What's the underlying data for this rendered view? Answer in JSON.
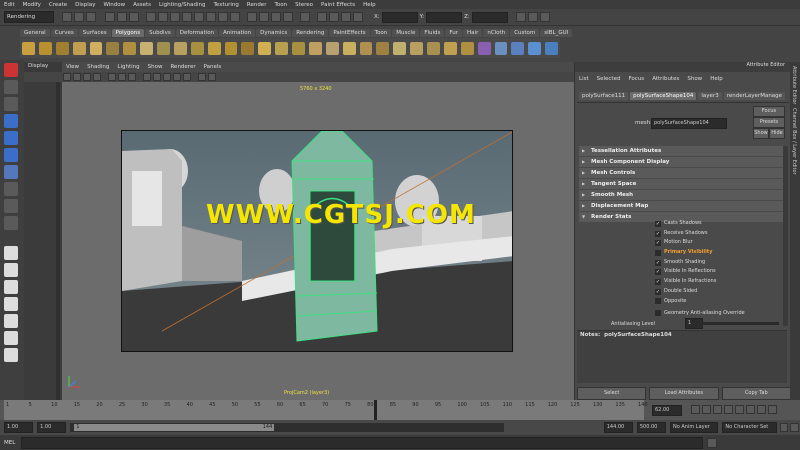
{
  "menubar": {
    "items": [
      "Edit",
      "Modify",
      "Create",
      "Display",
      "Window",
      "Assets",
      "Lighting/Shading",
      "Texturing",
      "Render",
      "Toon",
      "Stereo",
      "Paint Effects",
      "Help"
    ]
  },
  "statusline": {
    "mode": "Rendering",
    "x_label": "X:",
    "y_label": "Y:",
    "z_label": "Z:"
  },
  "shelf_tabs": {
    "items": [
      "General",
      "Curves",
      "Surfaces",
      "Polygons",
      "Subdivs",
      "Deformation",
      "Animation",
      "Dynamics",
      "Rendering",
      "PaintEffects",
      "Toon",
      "Muscle",
      "Fluids",
      "Fur",
      "Hair",
      "nCloth",
      "Custom",
      "sIBL_GUI"
    ],
    "active": "Polygons"
  },
  "viewport": {
    "layer_header": "Display",
    "menu": [
      "View",
      "Shading",
      "Lighting",
      "Show",
      "Renderer",
      "Panels"
    ],
    "resolution": "5760 x 3240",
    "camera_label": "ProjCam2 (layer3)"
  },
  "watermark": "WWW.CGTSJ.COM",
  "attribute_editor": {
    "title": "Attribute Editor",
    "menu": [
      "List",
      "Selected",
      "Focus",
      "Attributes",
      "Show",
      "Help"
    ],
    "tabs": [
      "polySurface111",
      "polySurfaceShape104",
      "layer3",
      "renderLayerManage"
    ],
    "active_tab": "polySurfaceShape104",
    "mesh_label": "mesh:",
    "mesh_value": "polySurfaceShape104",
    "focus_label": "Focus",
    "presets_label": "Presets",
    "show_label": "Show",
    "hide_label": "Hide",
    "sections": [
      "Tessellation Attributes",
      "Mesh Component Display",
      "Mesh Controls",
      "Tangent Space",
      "Smooth Mesh",
      "Displacement Map",
      "Render Stats"
    ],
    "render_stats": [
      {
        "label": "Casts Shadows",
        "checked": true
      },
      {
        "label": "Receive Shadows",
        "checked": true
      },
      {
        "label": "Motion Blur",
        "checked": true
      },
      {
        "label": "Primary Visibility",
        "checked": false,
        "highlight": true
      },
      {
        "label": "Smooth Shading",
        "checked": true
      },
      {
        "label": "Visible In Reflections",
        "checked": true
      },
      {
        "label": "Visible In Refractions",
        "checked": true
      },
      {
        "label": "Double Sided",
        "checked": true
      },
      {
        "label": "Opposite",
        "checked": false
      }
    ],
    "geo_aa_label": "Geometry Anti-aliasing Override",
    "aa_level_label": "Antialiasing Level",
    "aa_level_value": "1",
    "notes_label": "Notes:",
    "notes_value": "polySurfaceShape104",
    "buttons": {
      "select": "Select",
      "load": "Load Attributes",
      "copy": "Copy Tab"
    }
  },
  "side_tabs": [
    "Attribute Editor",
    "Channel Box / Layer Editor"
  ],
  "timeline": {
    "ticks": [
      "1",
      "5",
      "10",
      "15",
      "20",
      "25",
      "30",
      "35",
      "40",
      "45",
      "50",
      "55",
      "60",
      "65",
      "70",
      "75",
      "80",
      "85",
      "90",
      "95",
      "100",
      "105",
      "110",
      "115",
      "120",
      "125",
      "130",
      "135",
      "140"
    ],
    "current_frame": "62.00",
    "start_time": "1.00",
    "start_range": "1.00",
    "range_start": "1",
    "range_end": "144",
    "end_range": "144.00",
    "end_time": "500.00",
    "anim_layer": "No Anim Layer",
    "character_set": "No Character Set"
  },
  "cmdline": {
    "label": "MEL"
  },
  "colors": {
    "accent": "#3fe080",
    "highlight": "#f0a030",
    "watermark": "#f5e600"
  }
}
